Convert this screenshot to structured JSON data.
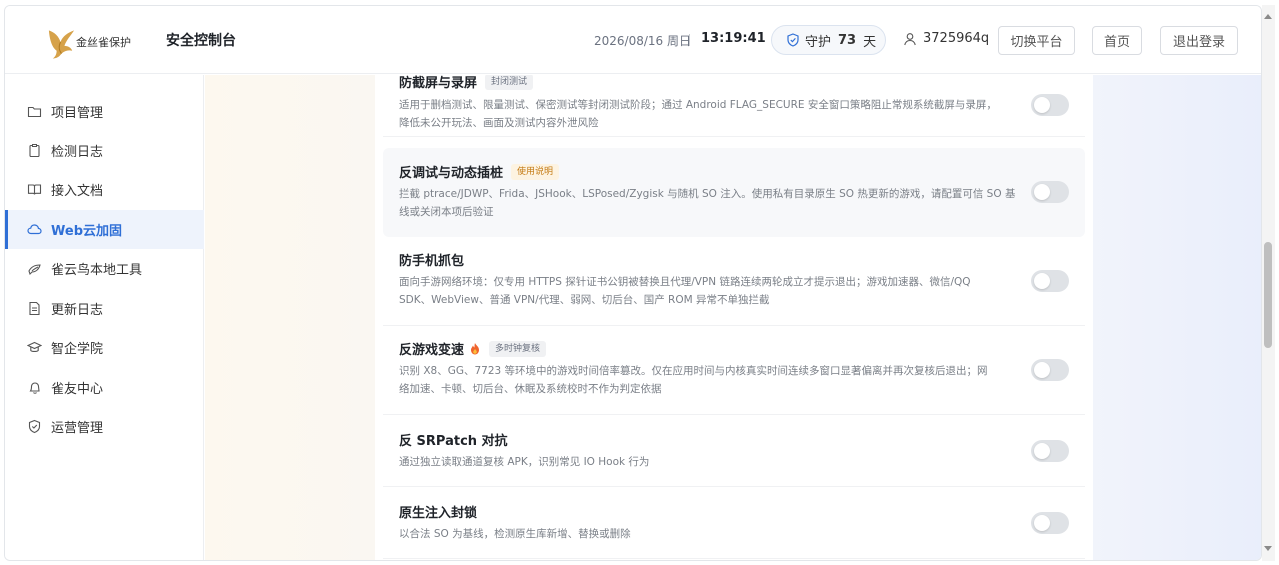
{
  "header": {
    "logo_text": "金丝雀保护",
    "console_title": "安全控制台",
    "date": "2026/08/16 周日",
    "time": "13:19:41",
    "guard_label": "守护",
    "guard_days": "73",
    "guard_unit": "天",
    "user": "3725964q",
    "switch_platform": "切换平台",
    "home": "首页",
    "logout": "退出登录"
  },
  "sidebar": {
    "items": [
      {
        "label": "项目管理",
        "icon": "folder-icon"
      },
      {
        "label": "检测日志",
        "icon": "clipboard-icon"
      },
      {
        "label": "接入文档",
        "icon": "book-icon"
      },
      {
        "label": "Web云加固",
        "icon": "cloud-icon",
        "active": true
      },
      {
        "label": "雀云鸟本地工具",
        "icon": "bird-icon"
      },
      {
        "label": "更新日志",
        "icon": "document-icon"
      },
      {
        "label": "智企学院",
        "icon": "graduation-cap-icon"
      },
      {
        "label": "雀友中心",
        "icon": "bell-icon"
      },
      {
        "label": "运营管理",
        "icon": "shield-icon"
      }
    ]
  },
  "cards": [
    {
      "title": "防截屏与录屏",
      "tag": "封闭测试",
      "desc_line1": "适用于删档测试、限量测试、保密测试等封闭测试阶段；通过 Android FLAG_SECURE 安全窗口策略阻止常规系统截屏与录屏，",
      "desc_line2": "降低未公开玩法、画面及测试内容外泄风险",
      "enabled": false
    },
    {
      "title": "反调试与动态插桩",
      "tag": "使用说明",
      "desc_line1": "拦截 ptrace/JDWP、Frida、JSHook、LSPosed/Zygisk 与随机 SO 注入。使用私有目录原生 SO 热更新的游戏，请配置可信 SO 基",
      "desc_line2": "线或关闭本项后验证",
      "enabled": false
    },
    {
      "title": "防手机抓包",
      "desc_line1": "面向手游网络环境：仅专用 HTTPS 探针证书公钥被替换且代理/VPN 链路连续两轮成立才提示退出；游戏加速器、微信/QQ",
      "desc_line2": "SDK、WebView、普通 VPN/代理、弱网、切后台、国产 ROM 异常不单独拦截",
      "enabled": false
    },
    {
      "title": "反游戏变速",
      "tag": "多时钟复核",
      "desc_line1": "识别 X8、GG、7723 等环境中的游戏时间倍率篡改。仅在应用时间与内核真实时间连续多窗口显著偏离并再次复核后退出；网",
      "desc_line2": "络加速、卡顿、切后台、休眠及系统校时不作为判定依据",
      "enabled": false
    },
    {
      "title": "反 SRPatch 对抗",
      "desc_line1": "通过独立读取通道复核 APK，识别常见 IO Hook 行为",
      "enabled": false
    },
    {
      "title": "原生注入封锁",
      "desc_line1": "以合法 SO 为基线，检测原生库新增、替换或删除",
      "enabled": false
    }
  ]
}
